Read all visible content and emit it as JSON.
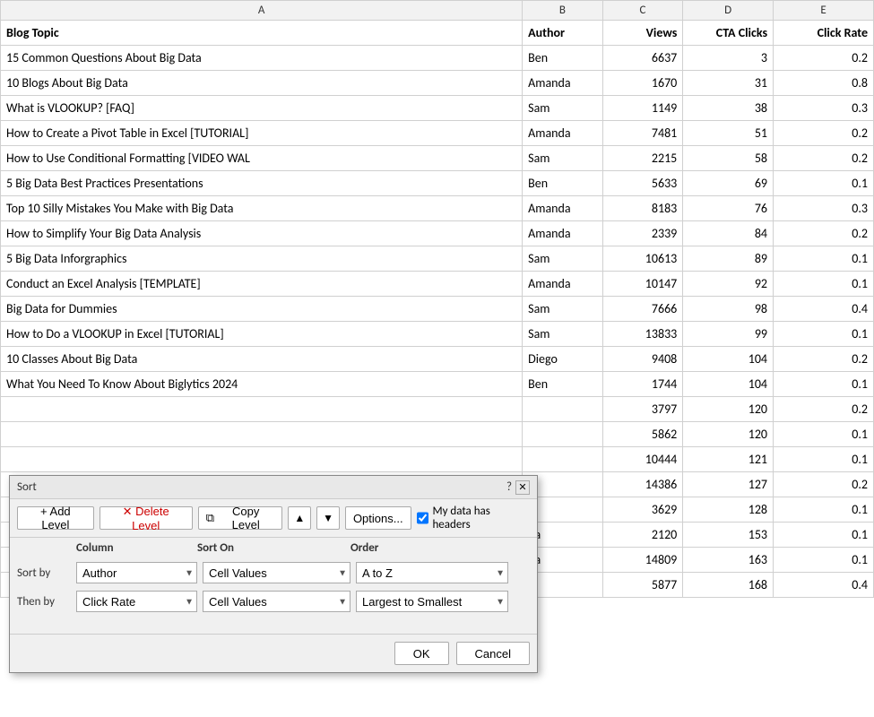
{
  "columns": {
    "letters": [
      "A",
      "B",
      "C",
      "D",
      "E"
    ],
    "headers": [
      "Blog Topic",
      "Author",
      "Views",
      "CTA Clicks",
      "Click Rate"
    ]
  },
  "rows": [
    [
      "15 Common Questions About Big Data",
      "Ben",
      "6637",
      "3",
      "0.2"
    ],
    [
      "10 Blogs About Big Data",
      "Amanda",
      "1670",
      "31",
      "0.8"
    ],
    [
      "What is VLOOKUP? [FAQ]",
      "Sam",
      "1149",
      "38",
      "0.3"
    ],
    [
      "How to Create a Pivot Table in Excel [TUTORIAL]",
      "Amanda",
      "7481",
      "51",
      "0.2"
    ],
    [
      "How to Use Conditional Formatting [VIDEO WAL",
      "Sam",
      "2215",
      "58",
      "0.2"
    ],
    [
      "5 Big Data Best Practices Presentations",
      "Ben",
      "5633",
      "69",
      "0.1"
    ],
    [
      "Top 10 Silly Mistakes You Make with Big Data",
      "Amanda",
      "8183",
      "76",
      "0.3"
    ],
    [
      "How to Simplify Your Big Data Analysis",
      "Amanda",
      "2339",
      "84",
      "0.2"
    ],
    [
      "5 Big Data Inforgraphics",
      "Sam",
      "10613",
      "89",
      "0.1"
    ],
    [
      "Conduct an Excel Analysis [TEMPLATE]",
      "Amanda",
      "10147",
      "92",
      "0.1"
    ],
    [
      "Big Data for Dummies",
      "Sam",
      "7666",
      "98",
      "0.4"
    ],
    [
      "How to Do a VLOOKUP in Excel [TUTORIAL]",
      "Sam",
      "13833",
      "99",
      "0.1"
    ],
    [
      "10 Classes About Big Data",
      "Diego",
      "9408",
      "104",
      "0.2"
    ],
    [
      "What You Need To Know About Biglytics 2024",
      "Ben",
      "1744",
      "104",
      "0.1"
    ],
    [
      "",
      "",
      "3797",
      "120",
      "0.2"
    ],
    [
      "",
      "",
      "5862",
      "120",
      "0.1"
    ],
    [
      "",
      "",
      "10444",
      "121",
      "0.1"
    ],
    [
      "",
      "",
      "14386",
      "127",
      "0.2"
    ],
    [
      "",
      "",
      "3629",
      "128",
      "0.1"
    ],
    [
      "",
      "da",
      "2120",
      "153",
      "0.1"
    ],
    [
      "",
      "da",
      "14809",
      "163",
      "0.1"
    ],
    [
      "",
      "",
      "5877",
      "168",
      "0.4"
    ]
  ],
  "dialog": {
    "title": "Sort",
    "help_symbol": "?",
    "close_symbol": "✕",
    "toolbar": {
      "add_level": "+ Add Level",
      "delete_level": "✕ Delete Level",
      "copy_level": "Copy Level",
      "copy_level_icon": "⧉",
      "move_up_icon": "▲",
      "move_down_icon": "▼",
      "options_label": "Options...",
      "checkbox_label": "My data has headers",
      "checkbox_checked": true
    },
    "col_headers": {
      "column": "Column",
      "sort_on": "Sort On",
      "order": "Order"
    },
    "sort_rows": [
      {
        "label": "Sort by",
        "column_value": "Author",
        "sort_on_value": "Cell Values",
        "order_value": "A to Z"
      },
      {
        "label": "Then by",
        "column_value": "Click Rate",
        "sort_on_value": "Cell Values",
        "order_value": "Largest to Smallest"
      }
    ],
    "footer": {
      "ok_label": "OK",
      "cancel_label": "Cancel"
    }
  }
}
